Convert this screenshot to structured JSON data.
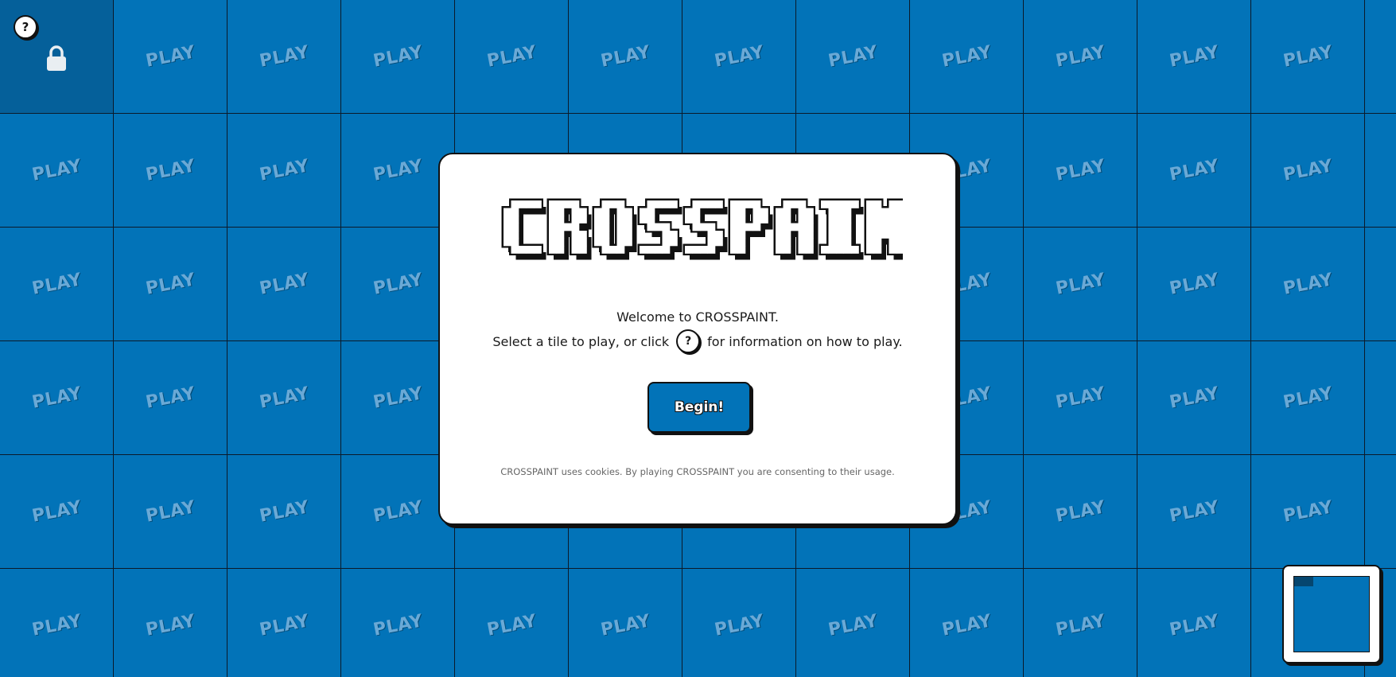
{
  "game": {
    "title": "CROSSPAINT",
    "help_icon": "?"
  },
  "grid": {
    "rows": 6,
    "cols": 13,
    "tile_label": "PLAY",
    "locked_tiles": [
      [
        0,
        0
      ]
    ],
    "tile_color": "#0273b8",
    "locked_tile_color": "#05609a"
  },
  "modal": {
    "logo_text": "CROSSPAINT",
    "welcome": "Welcome to CROSSPAINT.",
    "instruction_before": "Select a tile to play, or click",
    "instruction_icon": "?",
    "instruction_after": "for information on how to play.",
    "begin_label": "Begin!",
    "cookie_notice": "CROSSPAINT uses cookies. By playing CROSSPAINT you are consenting to their usage."
  },
  "minimap": {
    "icon": "minimap-icon"
  },
  "colors": {
    "accent": "#0273b8",
    "dark": "#111111"
  }
}
